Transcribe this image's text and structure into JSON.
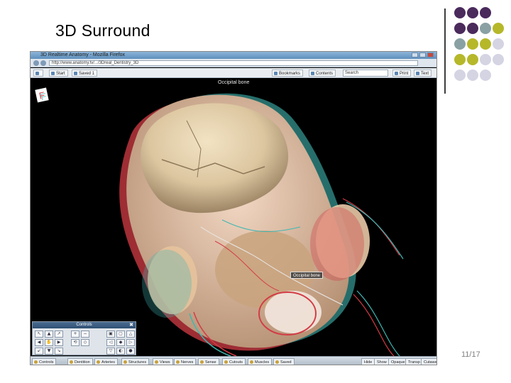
{
  "slide": {
    "title": "3D Surround",
    "page_number": "11/17",
    "accent_colors": [
      "#4b2a5c",
      "#8aa1a3",
      "#b6b82a",
      "#d4d4e3"
    ]
  },
  "browser": {
    "window_title": "3D Realtime Anatomy - Mozilla Firefox",
    "url": "http://www.anatomy.tv/.../3Dreal_Dentistry_3D",
    "toolbar": {
      "start_label": "Start",
      "saved_label": "Saved 1",
      "bookmarks_label": "Bookmarks",
      "contents_label": "Contents",
      "search_value": "Search",
      "print_label": "Print",
      "text_label": "Text"
    }
  },
  "viewer": {
    "structure_label": "Occipital bone",
    "tooltip": "Occipital bone"
  },
  "controls_panel": {
    "title": "Controls",
    "close": "✖"
  },
  "taskbar": {
    "tabs": [
      "Controls",
      "Dentition",
      "Arteries",
      "Structures",
      "Views",
      "Nerves",
      "Sense",
      "Cutouts",
      "Muscles",
      "Saved"
    ],
    "right_tabs": [
      "Hide",
      "Show",
      "Opaque",
      "Transp",
      "Cutaway"
    ]
  }
}
